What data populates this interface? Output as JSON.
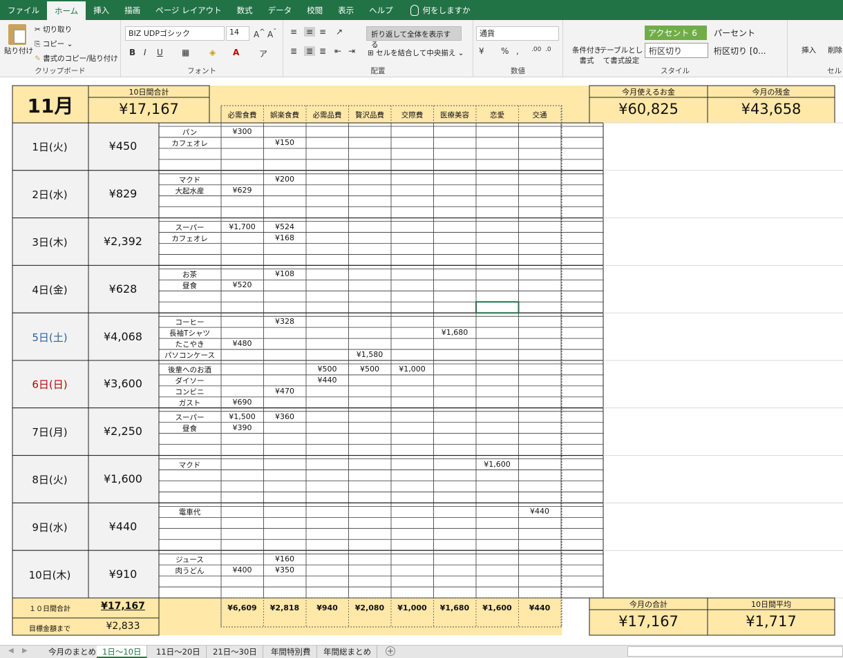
{
  "menu": [
    "ファイル",
    "ホーム",
    "挿入",
    "描画",
    "ページ レイアウト",
    "数式",
    "データ",
    "校閲",
    "表示",
    "ヘルプ"
  ],
  "menu_active": "ホーム",
  "tell_me": "何をしますか",
  "ribbon": {
    "clipboard": {
      "paste": "貼り付け",
      "cut": "切り取り",
      "copy": "コピー",
      "format_painter": "書式のコピー/貼り付け",
      "label": "クリップボード"
    },
    "font": {
      "name": "BIZ UDPゴシック",
      "size": "14",
      "label": "フォント"
    },
    "alignment": {
      "wrap": "折り返して全体を表示する",
      "merge": "セルを結合して中央揃え",
      "label": "配置"
    },
    "number": {
      "format": "通貨",
      "label": "数値"
    },
    "styles": {
      "conditional": "条件付き書式",
      "table": "テーブルとして書式設定",
      "style1": "アクセント 6",
      "style2": "パーセント",
      "style3": "桁区切り",
      "style4": "桁区切り [0...",
      "label": "スタイル"
    },
    "cells": {
      "insert": "挿入",
      "delete": "削除",
      "label": "セル"
    }
  },
  "header": {
    "month": "11月",
    "ten_day_label": "10日間合計",
    "ten_day_total": "¥17,167",
    "usable_label": "今月使えるお金",
    "usable_value": "¥60,825",
    "remaining_label": "今月の残金",
    "remaining_value": "¥43,658"
  },
  "categories": [
    "必需食費",
    "娯楽食費",
    "必需品費",
    "贅沢品費",
    "交際費",
    "医療美容",
    "恋愛",
    "交通"
  ],
  "days": [
    {
      "label": "1日(火)",
      "total": "¥450",
      "color": "#111111",
      "rows": [
        [
          "パン",
          "¥300",
          "",
          "",
          "",
          "",
          "",
          "",
          ""
        ],
        [
          "カフェオレ",
          "",
          "¥150",
          "",
          "",
          "",
          "",
          "",
          ""
        ]
      ]
    },
    {
      "label": "2日(水)",
      "total": "¥829",
      "color": "#111111",
      "rows": [
        [
          "マクド",
          "",
          "¥200",
          "",
          "",
          "",
          "",
          "",
          ""
        ],
        [
          "大起水産",
          "¥629",
          "",
          "",
          "",
          "",
          "",
          "",
          ""
        ]
      ]
    },
    {
      "label": "3日(木)",
      "total": "¥2,392",
      "color": "#111111",
      "rows": [
        [
          "スーパー",
          "¥1,700",
          "¥524",
          "",
          "",
          "",
          "",
          "",
          ""
        ],
        [
          "カフェオレ",
          "",
          "¥168",
          "",
          "",
          "",
          "",
          "",
          ""
        ]
      ]
    },
    {
      "label": "4日(金)",
      "total": "¥628",
      "color": "#111111",
      "rows": [
        [
          "お茶",
          "",
          "¥108",
          "",
          "",
          "",
          "",
          "",
          ""
        ],
        [
          "昼食",
          "¥520",
          "",
          "",
          "",
          "",
          "",
          "",
          ""
        ]
      ]
    },
    {
      "label": "5日(土)",
      "total": "¥4,068",
      "color": "#2e5f9e",
      "rows": [
        [
          "コーヒー",
          "",
          "¥328",
          "",
          "",
          "",
          "",
          "",
          ""
        ],
        [
          "長袖Tシャツ",
          "",
          "",
          "",
          "",
          "",
          "¥1,680",
          "",
          ""
        ],
        [
          "たこやき",
          "¥480",
          "",
          "",
          "",
          "",
          "",
          "",
          ""
        ],
        [
          "パソコンケース",
          "",
          "",
          "",
          "¥1,580",
          "",
          "",
          "",
          ""
        ]
      ]
    },
    {
      "label": "6日(日)",
      "total": "¥3,600",
      "color": "#c00000",
      "rows": [
        [
          "後輩へのお酒",
          "",
          "",
          "¥500",
          "¥500",
          "¥1,000",
          "",
          "",
          ""
        ],
        [
          "ダイソー",
          "",
          "",
          "¥440",
          "",
          "",
          "",
          "",
          ""
        ],
        [
          "コンビニ",
          "",
          "¥470",
          "",
          "",
          "",
          "",
          "",
          ""
        ],
        [
          "ガスト",
          "¥690",
          "",
          "",
          "",
          "",
          "",
          "",
          ""
        ]
      ]
    },
    {
      "label": "7日(月)",
      "total": "¥2,250",
      "color": "#111111",
      "rows": [
        [
          "スーパー",
          "¥1,500",
          "¥360",
          "",
          "",
          "",
          "",
          "",
          ""
        ],
        [
          "昼食",
          "¥390",
          "",
          "",
          "",
          "",
          "",
          "",
          ""
        ]
      ]
    },
    {
      "label": "8日(火)",
      "total": "¥1,600",
      "color": "#111111",
      "rows": [
        [
          "マクド",
          "",
          "",
          "",
          "",
          "",
          "",
          "¥1,600",
          ""
        ]
      ]
    },
    {
      "label": "9日(水)",
      "total": "¥440",
      "color": "#111111",
      "rows": [
        [
          "電車代",
          "",
          "",
          "",
          "",
          "",
          "",
          "",
          "¥440"
        ]
      ]
    },
    {
      "label": "10日(木)",
      "total": "¥910",
      "color": "#111111",
      "rows": [
        [
          "ジュース",
          "",
          "¥160",
          "",
          "",
          "",
          "",
          "",
          ""
        ],
        [
          "肉うどん",
          "¥400",
          "¥350",
          "",
          "",
          "",
          "",
          "",
          ""
        ]
      ]
    }
  ],
  "footer": {
    "ten_day_label": "１０日間合計",
    "ten_day_value": "¥17,167",
    "target_label": "目標金額まで",
    "target_value": "¥2,833",
    "category_totals": [
      "¥6,609",
      "¥2,818",
      "¥940",
      "¥2,080",
      "¥1,000",
      "¥1,680",
      "¥1,600",
      "¥440"
    ],
    "month_total_label": "今月の合計",
    "month_total_value": "¥17,167",
    "avg_label": "10日間平均",
    "avg_value": "¥1,717"
  },
  "tabs": [
    "今月のまとめ",
    "1日〜10日",
    "11日〜20日",
    "21日〜30日",
    "年間特別費",
    "年間総まとめ"
  ],
  "tab_active": "1日〜10日",
  "colors": {
    "excel_green": "#217346",
    "header_yellow": "#ffe8a8",
    "day_gray": "#f2f2f2"
  }
}
